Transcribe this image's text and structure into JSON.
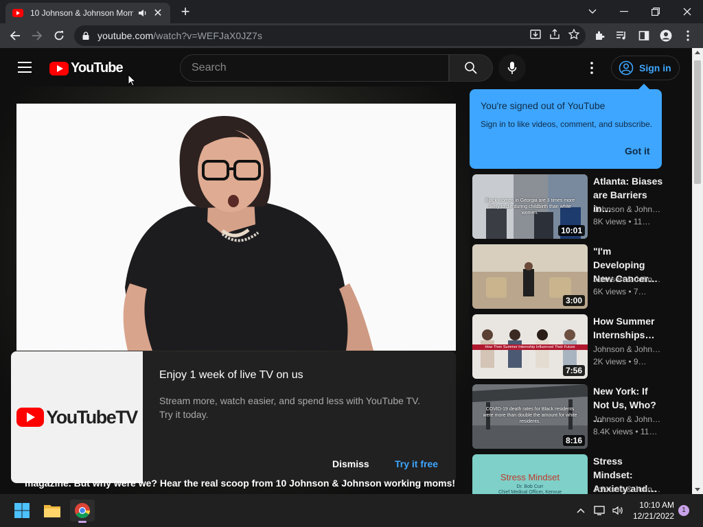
{
  "browser": {
    "tab_title": "10 Johnson & Johnson Mom",
    "tab_close": "✕",
    "new_tab": "+",
    "url_host": "youtube.com",
    "url_path": "/watch?v=WEFJaX0JZ7s"
  },
  "masthead": {
    "logo_text": "YouTube",
    "search_placeholder": "Search",
    "signin_label": "Sign in"
  },
  "tooltip": {
    "title": "You're signed out of YouTube",
    "body": "Sign in to like videos, comment, and subscribe.",
    "button": "Got it"
  },
  "promo": {
    "logo_text": "YouTubeTV",
    "title": "Enjoy 1 week of live TV on us",
    "body": "Stream more, watch easier, and spend less with YouTube TV. Try it today.",
    "dismiss": "Dismiss",
    "try_free": "Try it free"
  },
  "description_peek": "magazine. But why were we? Hear the real scoop from 10 Johnson & Johnson working moms!",
  "related": [
    {
      "title": "Atlanta: Biases\nare Barriers in…",
      "channel": "Johnson & John…",
      "meta": "8K views  •  11…",
      "duration": "10:01",
      "thumb_text": "Black women in Georgia are 3 times more likely to die during childbirth than white women."
    },
    {
      "title": "\"I'm Developing\nNew Cancer…",
      "channel": "Johnson & John…",
      "meta": "6K views  •  7…",
      "duration": "3:00",
      "thumb_text": ""
    },
    {
      "title": "How Summer\nInternships…",
      "channel": "Johnson & John…",
      "meta": "2K views  •  9…",
      "duration": "7:56",
      "thumb_text": "How Their Summer Internship Influenced Their Future"
    },
    {
      "title": "New York: If\nNot Us, Who? …",
      "channel": "Johnson & John…",
      "meta": "8.4K views  •  11…",
      "duration": "8:16",
      "thumb_text": "COVID-19 death rates for Black residents were more than double the amount for white residents."
    },
    {
      "title": "Stress Mindset:\nAnxiety and…",
      "channel": "Johnson & John…",
      "meta": "",
      "duration": "",
      "thumb_text": "Stress Mindset",
      "thumb_subtext": "Dr. Bob Curr\nChief Medical Officer, Kenvue"
    }
  ],
  "taskbar": {
    "time": "10:10 AM",
    "date": "12/21/2022",
    "notif_count": "1"
  }
}
